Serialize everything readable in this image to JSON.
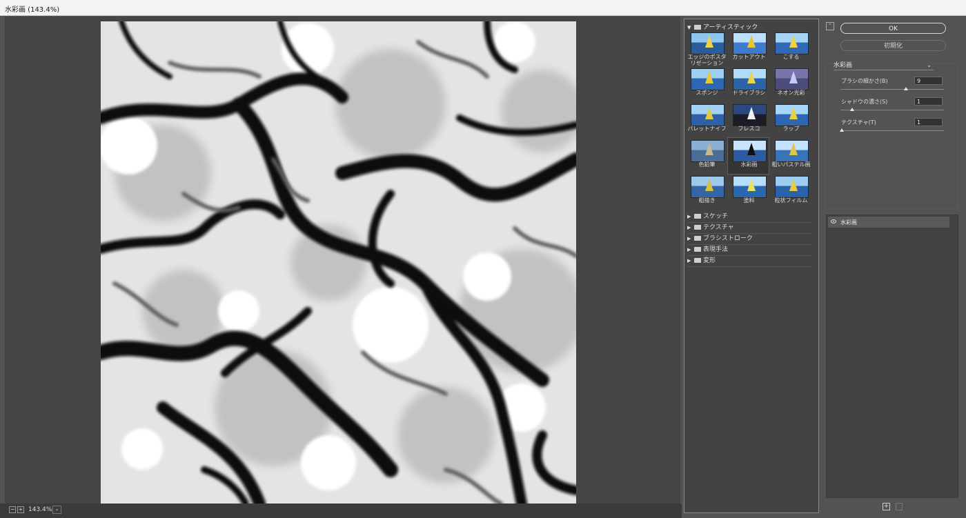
{
  "window": {
    "title": "水彩画 (143.4%)"
  },
  "zoom": {
    "level": "143.4%",
    "minus": "−",
    "plus": "+",
    "dropdown": "⌄"
  },
  "gallery": {
    "category_open": "アーティスティック",
    "filters": [
      {
        "label": "エッジのポスタリゼーション",
        "label2": ""
      },
      {
        "label": "カットアウト"
      },
      {
        "label": "こする"
      },
      {
        "label": "スポンジ"
      },
      {
        "label": "ドライブラシ"
      },
      {
        "label": "ネオン光彩"
      },
      {
        "label": "パレットナイフ"
      },
      {
        "label": "フレスコ"
      },
      {
        "label": "ラップ"
      },
      {
        "label": "色鉛筆"
      },
      {
        "label": "水彩画"
      },
      {
        "label": "粗いパステル画"
      },
      {
        "label": "粗描き"
      },
      {
        "label": "塗料"
      },
      {
        "label": "粒状フィルム"
      }
    ],
    "selected_index": 10,
    "categories": [
      "スケッチ",
      "テクスチャ",
      "ブラシストローク",
      "表現手法",
      "変形"
    ]
  },
  "buttons": {
    "ok": "OK",
    "reset": "初期化",
    "collapse": "⌃"
  },
  "settings": {
    "filter": "水彩画",
    "params": [
      {
        "label": "ブラシの細かさ(B)",
        "value": "9",
        "fraction": 0.64
      },
      {
        "label": "シャドウの濃さ(S)",
        "value": "1",
        "fraction": 0.1
      },
      {
        "label": "テクスチャ(T)",
        "value": "1",
        "fraction": 0.0
      }
    ]
  },
  "layers": {
    "items": [
      {
        "name": "水彩画"
      }
    ]
  },
  "colors": {
    "panel": "#535353",
    "preview_bg": "#454545",
    "gallery_bg": "#434343"
  }
}
